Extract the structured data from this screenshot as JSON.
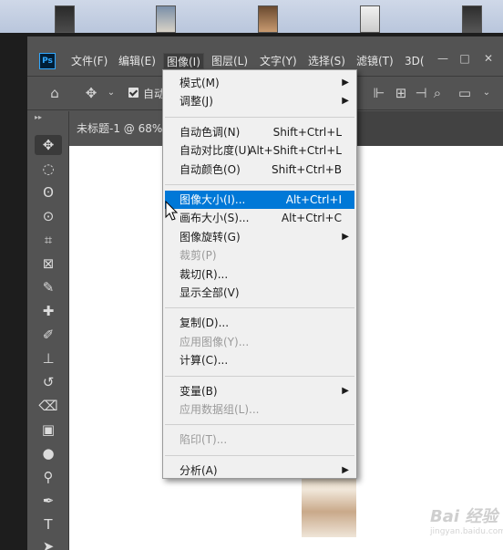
{
  "app": {
    "logo": "Ps",
    "window_controls": [
      "—",
      "□",
      "✕"
    ]
  },
  "menubar": {
    "items": [
      "文件(F)",
      "编辑(E)",
      "图像(I)",
      "图层(L)",
      "文字(Y)",
      "选择(S)",
      "滤镜(T)",
      "3D("
    ],
    "active_item": "图像(I)"
  },
  "options_bar": {
    "auto_select_label": "自动"
  },
  "toolbar": {
    "collapse_label": "▸▸"
  },
  "document": {
    "tab_label": "未标题-1 @ 68%"
  },
  "image_menu": {
    "items": [
      {
        "label": "模式(M)",
        "shortcut": "",
        "submenu": true,
        "disabled": false,
        "highlight": false
      },
      {
        "label": "调整(J)",
        "shortcut": "",
        "submenu": true,
        "disabled": false,
        "highlight": false
      },
      {
        "label": "自动色调(N)",
        "shortcut": "Shift+Ctrl+L",
        "submenu": false,
        "disabled": false,
        "highlight": false
      },
      {
        "label": "自动对比度(U)",
        "shortcut": "Alt+Shift+Ctrl+L",
        "submenu": false,
        "disabled": false,
        "highlight": false
      },
      {
        "label": "自动颜色(O)",
        "shortcut": "Shift+Ctrl+B",
        "submenu": false,
        "disabled": false,
        "highlight": false
      },
      {
        "label": "图像大小(I)...",
        "shortcut": "Alt+Ctrl+I",
        "submenu": false,
        "disabled": false,
        "highlight": true
      },
      {
        "label": "画布大小(S)...",
        "shortcut": "Alt+Ctrl+C",
        "submenu": false,
        "disabled": false,
        "highlight": false
      },
      {
        "label": "图像旋转(G)",
        "shortcut": "",
        "submenu": true,
        "disabled": false,
        "highlight": false
      },
      {
        "label": "裁剪(P)",
        "shortcut": "",
        "submenu": false,
        "disabled": true,
        "highlight": false
      },
      {
        "label": "裁切(R)...",
        "shortcut": "",
        "submenu": false,
        "disabled": false,
        "highlight": false
      },
      {
        "label": "显示全部(V)",
        "shortcut": "",
        "submenu": false,
        "disabled": false,
        "highlight": false
      },
      {
        "label": "复制(D)...",
        "shortcut": "",
        "submenu": false,
        "disabled": false,
        "highlight": false
      },
      {
        "label": "应用图像(Y)...",
        "shortcut": "",
        "submenu": false,
        "disabled": true,
        "highlight": false
      },
      {
        "label": "计算(C)...",
        "shortcut": "",
        "submenu": false,
        "disabled": false,
        "highlight": false
      },
      {
        "label": "变量(B)",
        "shortcut": "",
        "submenu": true,
        "disabled": false,
        "highlight": false
      },
      {
        "label": "应用数据组(L)...",
        "shortcut": "",
        "submenu": false,
        "disabled": true,
        "highlight": false
      },
      {
        "label": "陷印(T)...",
        "shortcut": "",
        "submenu": false,
        "disabled": true,
        "highlight": false
      },
      {
        "label": "分析(A)",
        "shortcut": "",
        "submenu": true,
        "disabled": false,
        "highlight": false
      }
    ]
  },
  "watermark": {
    "brand": "Bai 经验",
    "url": "jingyan.baidu.com"
  },
  "colors": {
    "highlight": "#0078d7",
    "menu_bg": "#f0f0f0",
    "app_bg": "#535353"
  }
}
